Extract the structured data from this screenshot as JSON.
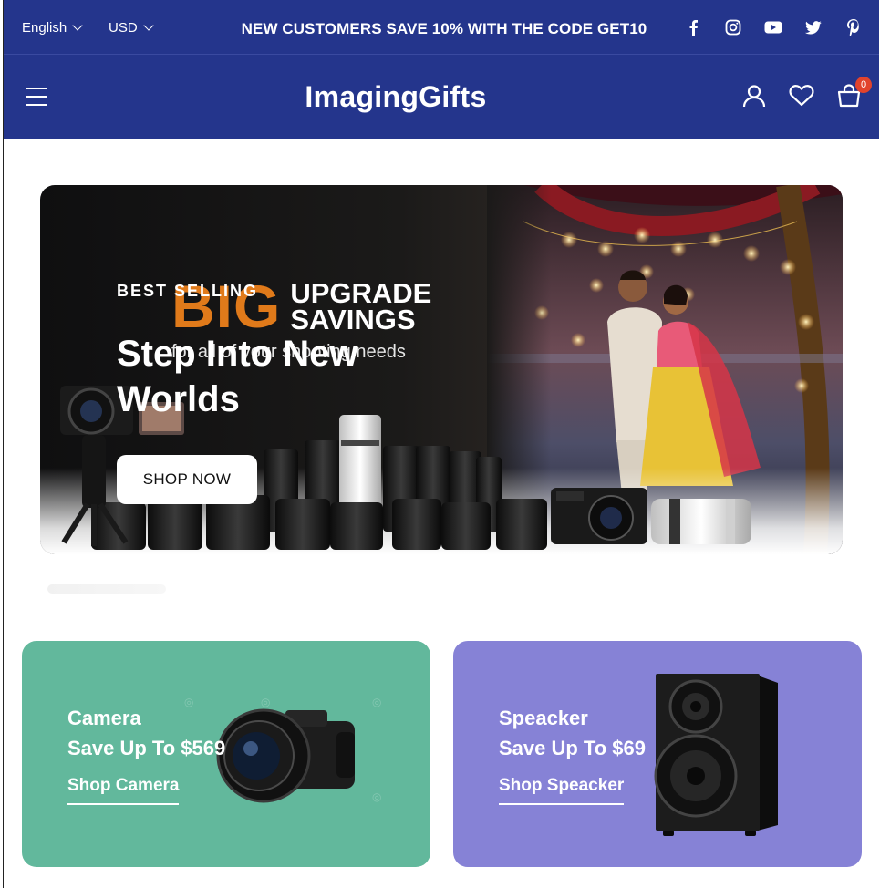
{
  "topbar": {
    "language": "English",
    "currency": "USD",
    "promo": "NEW CUSTOMERS SAVE 10% WITH THE CODE GET10",
    "social_icons": [
      "facebook-icon",
      "instagram-icon",
      "youtube-icon",
      "twitter-icon",
      "pinterest-icon"
    ]
  },
  "header": {
    "logo": "ImagingGifts",
    "cart_count": "0",
    "icons": [
      "menu-icon",
      "account-icon",
      "wishlist-icon",
      "cart-icon"
    ]
  },
  "hero": {
    "eyebrow": "BEST SELLING",
    "banner_big": "BIG",
    "banner_line1": "UPGRADE",
    "banner_line2": "SAVINGS",
    "banner_tagline": "for all of your shooting needs",
    "title": "Step Into New Worlds",
    "cta": "SHOP NOW"
  },
  "cards": {
    "camera": {
      "title": "Camera",
      "subtitle": "Save Up To $569",
      "link": "Shop Camera",
      "bg": "#62b89c"
    },
    "speaker": {
      "title": "Speacker",
      "subtitle": "Save Up To $69",
      "link": "Shop Speacker",
      "bg": "#8682d6"
    }
  },
  "colors": {
    "brand": "#24358c",
    "badge": "#e2432c"
  }
}
